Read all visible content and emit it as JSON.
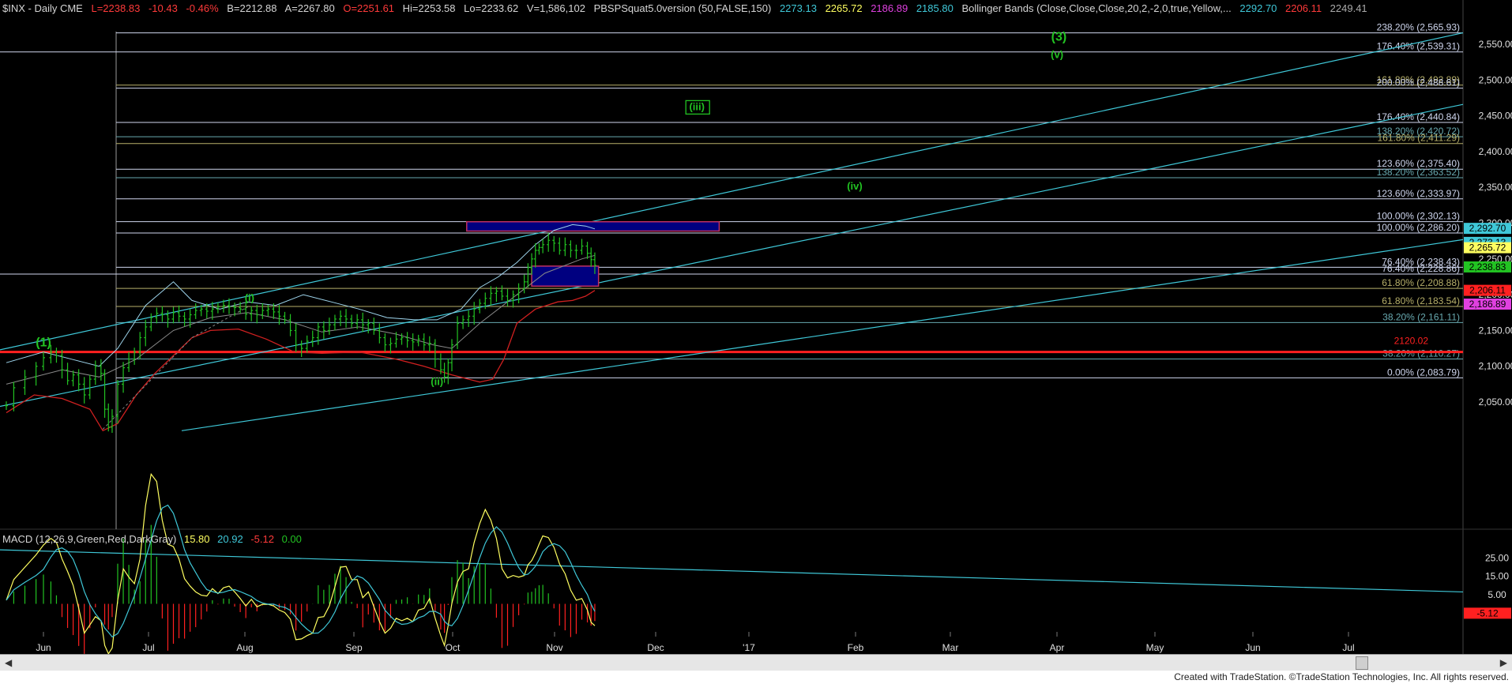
{
  "header": {
    "symbol": "$INX - Daily  CME",
    "last": "L=2238.83",
    "change": "-10.43",
    "change_pct": "-0.46%",
    "bid": "B=2212.88",
    "ask": "A=2267.80",
    "open": "O=2251.61",
    "hi": "Hi=2253.58",
    "lo": "Lo=2233.62",
    "vol": "V=1,586,102",
    "study1": "PBSPSquat5.0version (50,FALSE,150)",
    "s1v1": "2273.13",
    "s1v2": "2265.72",
    "s1v3": "2186.89",
    "s1v4": "2185.80",
    "study2": "Bollinger Bands (Close,Close,Close,20,2,-2,0,true,Yellow,...",
    "s2v1": "2292.70",
    "s2v2": "2206.11",
    "s2v3": "2249.41"
  },
  "macd_header": {
    "label": "MACD (12,26,9,Green,Red,DarkGray)",
    "v1": "15.80",
    "v2": "20.92",
    "v3": "-5.12",
    "v4": "0.00"
  },
  "footer": "Created with TradeStation. ©TradeStation Technologies, Inc. All rights reserved.",
  "colors": {
    "bg": "#000000",
    "bars": "#22c322",
    "cyan": "#3fc8d8",
    "lightblue": "#9fd6ee",
    "red": "#ff2020",
    "grey": "#9a9a9a",
    "fib_white": "#cfd6ee",
    "fib_olive": "#b7b06a",
    "fib_teal": "#68a9b0",
    "box_blue": "#000080",
    "wave_green": "#22c322"
  },
  "chart_data": {
    "type": "ohlc",
    "title": "$INX - Daily  CME",
    "price_axis": {
      "ylim": [
        2007,
        2592
      ],
      "ticks": [
        "2,050.00",
        "2,100.00",
        "2,150.00",
        "2,200.00",
        "2,250.00",
        "2,300.00",
        "2,350.00",
        "2,400.00",
        "2,450.00",
        "2,500.00",
        "2,550.00"
      ]
    },
    "months": [
      "Jun",
      "Jul",
      "Aug",
      "Sep",
      "Oct",
      "Nov",
      "Dec",
      "'17",
      "Feb",
      "Mar",
      "Apr",
      "May",
      "Jun",
      "Jul"
    ],
    "price_path": [
      [
        0,
        2045
      ],
      [
        4,
        2070
      ],
      [
        10,
        2085
      ],
      [
        16,
        2100
      ],
      [
        20,
        2112
      ],
      [
        24,
        2120
      ],
      [
        27,
        2115
      ],
      [
        30,
        2095
      ],
      [
        33,
        2080
      ],
      [
        36,
        2088
      ],
      [
        39,
        2075
      ],
      [
        42,
        2060
      ],
      [
        45,
        2082
      ],
      [
        48,
        2100
      ],
      [
        51,
        2090
      ],
      [
        53,
        2040
      ],
      [
        55,
        2015
      ],
      [
        57,
        2030
      ],
      [
        60,
        2075
      ],
      [
        63,
        2098
      ],
      [
        66,
        2110
      ],
      [
        69,
        2120
      ],
      [
        72,
        2140
      ],
      [
        75,
        2155
      ],
      [
        78,
        2168
      ],
      [
        81,
        2174
      ],
      [
        84,
        2172
      ],
      [
        87,
        2166
      ],
      [
        90,
        2175
      ],
      [
        93,
        2170
      ],
      [
        96,
        2166
      ],
      [
        99,
        2172
      ],
      [
        102,
        2178
      ],
      [
        105,
        2180
      ],
      [
        108,
        2177
      ],
      [
        111,
        2180
      ],
      [
        114,
        2183
      ],
      [
        117,
        2185
      ],
      [
        120,
        2183
      ],
      [
        123,
        2182
      ],
      [
        126,
        2180
      ],
      [
        129,
        2173
      ],
      [
        132,
        2178
      ],
      [
        135,
        2172
      ],
      [
        138,
        2178
      ],
      [
        141,
        2180
      ],
      [
        144,
        2176
      ],
      [
        147,
        2170
      ],
      [
        150,
        2165
      ],
      [
        153,
        2150
      ],
      [
        156,
        2130
      ],
      [
        159,
        2125
      ],
      [
        162,
        2135
      ],
      [
        165,
        2140
      ],
      [
        168,
        2155
      ],
      [
        171,
        2150
      ],
      [
        174,
        2158
      ],
      [
        177,
        2166
      ],
      [
        180,
        2170
      ],
      [
        183,
        2166
      ],
      [
        186,
        2160
      ],
      [
        189,
        2165
      ],
      [
        192,
        2158
      ],
      [
        195,
        2160
      ],
      [
        198,
        2150
      ],
      [
        201,
        2140
      ],
      [
        204,
        2130
      ],
      [
        207,
        2132
      ],
      [
        210,
        2138
      ],
      [
        213,
        2140
      ],
      [
        216,
        2136
      ],
      [
        219,
        2134
      ],
      [
        222,
        2138
      ],
      [
        225,
        2130
      ],
      [
        228,
        2132
      ],
      [
        231,
        2110
      ],
      [
        234,
        2095
      ],
      [
        236,
        2085
      ],
      [
        238,
        2105
      ],
      [
        240,
        2130
      ],
      [
        243,
        2160
      ],
      [
        246,
        2165
      ],
      [
        249,
        2170
      ],
      [
        252,
        2180
      ],
      [
        255,
        2188
      ],
      [
        258,
        2195
      ],
      [
        261,
        2202
      ],
      [
        264,
        2205
      ],
      [
        267,
        2198
      ],
      [
        270,
        2192
      ],
      [
        273,
        2200
      ],
      [
        276,
        2208
      ],
      [
        279,
        2218
      ],
      [
        281,
        2238
      ],
      [
        283,
        2250
      ],
      [
        285,
        2262
      ],
      [
        287,
        2266
      ],
      [
        289,
        2270
      ],
      [
        292,
        2276
      ],
      [
        295,
        2272
      ],
      [
        298,
        2262
      ],
      [
        301,
        2270
      ],
      [
        304,
        2262
      ],
      [
        307,
        2262
      ],
      [
        310,
        2268
      ],
      [
        313,
        2258
      ],
      [
        315,
        2249
      ],
      [
        317,
        2241
      ]
    ],
    "bollinger_mid": [
      [
        0,
        2075
      ],
      [
        30,
        2095
      ],
      [
        50,
        2085
      ],
      [
        70,
        2110
      ],
      [
        90,
        2150
      ],
      [
        110,
        2168
      ],
      [
        130,
        2175
      ],
      [
        150,
        2165
      ],
      [
        170,
        2148
      ],
      [
        190,
        2155
      ],
      [
        210,
        2145
      ],
      [
        230,
        2130
      ],
      [
        240,
        2125
      ],
      [
        255,
        2160
      ],
      [
        270,
        2190
      ],
      [
        290,
        2230
      ],
      [
        310,
        2250
      ],
      [
        317,
        2255
      ]
    ],
    "bollinger_upper": [
      [
        0,
        2105
      ],
      [
        20,
        2120
      ],
      [
        35,
        2110
      ],
      [
        50,
        2100
      ],
      [
        60,
        2125
      ],
      [
        75,
        2185
      ],
      [
        90,
        2218
      ],
      [
        100,
        2192
      ],
      [
        115,
        2180
      ],
      [
        130,
        2190
      ],
      [
        145,
        2185
      ],
      [
        160,
        2200
      ],
      [
        175,
        2190
      ],
      [
        190,
        2180
      ],
      [
        205,
        2168
      ],
      [
        220,
        2165
      ],
      [
        232,
        2165
      ],
      [
        245,
        2180
      ],
      [
        255,
        2210
      ],
      [
        265,
        2225
      ],
      [
        275,
        2245
      ],
      [
        285,
        2270
      ],
      [
        295,
        2290
      ],
      [
        305,
        2298
      ],
      [
        312,
        2296
      ],
      [
        317,
        2292
      ]
    ],
    "bollinger_lower": [
      [
        0,
        2035
      ],
      [
        15,
        2060
      ],
      [
        30,
        2055
      ],
      [
        45,
        2040
      ],
      [
        52,
        2010
      ],
      [
        60,
        2020
      ],
      [
        70,
        2060
      ],
      [
        80,
        2090
      ],
      [
        90,
        2115
      ],
      [
        100,
        2140
      ],
      [
        110,
        2150
      ],
      [
        125,
        2152
      ],
      [
        140,
        2138
      ],
      [
        155,
        2120
      ],
      [
        170,
        2118
      ],
      [
        190,
        2120
      ],
      [
        210,
        2110
      ],
      [
        225,
        2100
      ],
      [
        240,
        2088
      ],
      [
        255,
        2078
      ],
      [
        262,
        2082
      ],
      [
        268,
        2110
      ],
      [
        275,
        2160
      ],
      [
        285,
        2180
      ],
      [
        297,
        2190
      ],
      [
        305,
        2192
      ],
      [
        312,
        2198
      ],
      [
        317,
        2206
      ]
    ],
    "horizontal_levels": [
      {
        "label": "238.20% (2,565.93)",
        "value": 2565.93,
        "color": "fib_white"
      },
      {
        "label": "176.40% (2,539.31)",
        "value": 2539.31,
        "color": "fib_white"
      },
      {
        "label": "161.80% (2,492.89)",
        "value": 2492.89,
        "color": "fib_olive"
      },
      {
        "label": "200.00% (2,488.61)",
        "value": 2488.61,
        "color": "fib_white"
      },
      {
        "label": "176.40% (2,440.84)",
        "value": 2440.84,
        "color": "fib_white"
      },
      {
        "label": "138.20% (2,420.72)",
        "value": 2420.72,
        "color": "fib_teal"
      },
      {
        "label": "161.80% (2,411.29)",
        "value": 2411.29,
        "color": "fib_olive"
      },
      {
        "label": "123.60% (2,375.40)",
        "value": 2375.4,
        "color": "fib_white"
      },
      {
        "label": "138.20% (2,363.52)",
        "value": 2363.52,
        "color": "fib_teal"
      },
      {
        "label": "123.60% (2,333.97)",
        "value": 2333.97,
        "color": "fib_white"
      },
      {
        "label": "100.00% (2,302.13)",
        "value": 2302.13,
        "color": "fib_white"
      },
      {
        "label": "100.00% (2,286.20)",
        "value": 2286.2,
        "color": "fib_white"
      },
      {
        "label": "76.40% (2,238.43)",
        "value": 2238.43,
        "color": "fib_white"
      },
      {
        "label": "76.40% (2,228.86)",
        "value": 2228.86,
        "color": "fib_white"
      },
      {
        "label": "61.80% (2,208.88)",
        "value": 2208.88,
        "color": "fib_olive"
      },
      {
        "label": "61.80% (2,183.54)",
        "value": 2183.54,
        "color": "fib_olive"
      },
      {
        "label": "38.20% (2,161.11)",
        "value": 2161.11,
        "color": "fib_teal"
      },
      {
        "label": "38.20% (2,110.27)",
        "value": 2110.27,
        "color": "fib_teal"
      },
      {
        "label": "0.00% (2,083.79)",
        "value": 2083.79,
        "color": "fib_white"
      }
    ],
    "red_level": {
      "label": "2120.02",
      "value": 2120.02
    },
    "axis_flags": [
      {
        "value": 2292.7,
        "label": "2,292.70",
        "bg": "#3fc8d8"
      },
      {
        "value": 2273.13,
        "label": "2,273.13",
        "bg": "#3fc8d8"
      },
      {
        "value": 2265.72,
        "label": "2,265.72",
        "bg": "#ffff60"
      },
      {
        "value": 2238.83,
        "label": "2,238.83",
        "bg": "#22c322"
      },
      {
        "value": 2206.11,
        "label": "2,206.11",
        "bg": "#ff2020"
      },
      {
        "value": 2186.89,
        "label": "2,186.89",
        "bg": "#e040e0"
      }
    ],
    "boxes": [
      {
        "x0": 248,
        "x1": 384,
        "y0": 2302,
        "y1": 2289
      },
      {
        "x0": 283,
        "x1": 319,
        "y0": 2240,
        "y1": 2212
      }
    ],
    "wave_labels": [
      {
        "text": "(1)",
        "x": 20,
        "y": 2128,
        "boxed": false,
        "size": 16
      },
      {
        "text": "(i)",
        "x": 131,
        "y": 2191,
        "boxed": false,
        "size": 13
      },
      {
        "text": "(ii)",
        "x": 232,
        "y": 2074,
        "boxed": false,
        "size": 13
      },
      {
        "text": "(iii)",
        "x": 372,
        "y": 2458,
        "boxed": true,
        "size": 13
      },
      {
        "text": "(iv)",
        "x": 457,
        "y": 2347,
        "boxed": false,
        "size": 13
      },
      {
        "text": "(3)",
        "x": 567,
        "y": 2555,
        "boxed": false,
        "size": 16
      },
      {
        "text": "(v)",
        "x": 566,
        "y": 2531,
        "boxed": false,
        "size": 13
      }
    ],
    "macd": {
      "ylim": [
        -11,
        33
      ],
      "ticks": [
        "5.00",
        "15.00",
        "25.00"
      ],
      "last_label": "-5.12"
    }
  }
}
